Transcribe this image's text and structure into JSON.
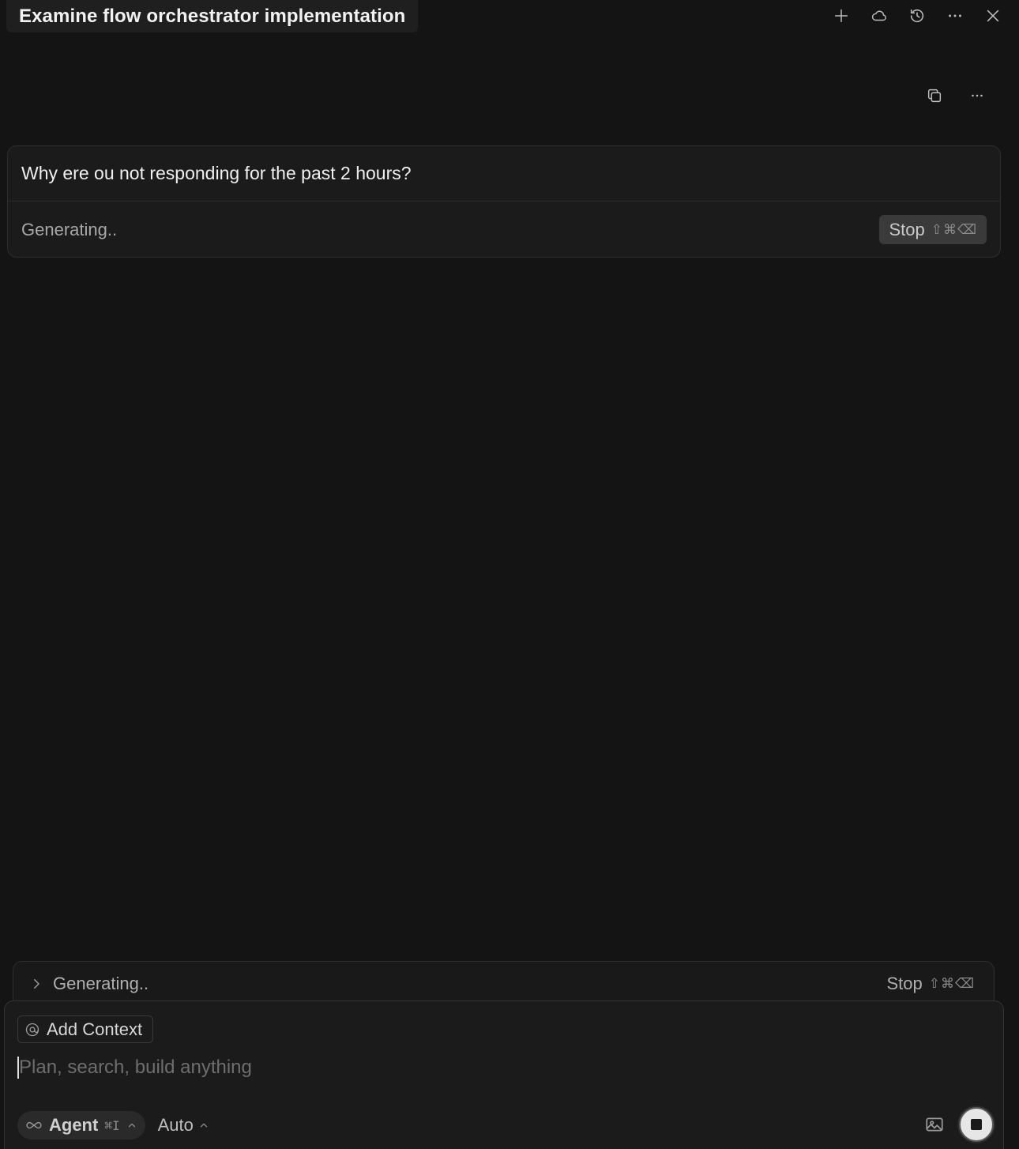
{
  "header": {
    "title": "Examine flow orchestrator implementation",
    "actions": [
      "plus-icon",
      "cloud-icon",
      "history-icon",
      "more-icon",
      "close-icon"
    ]
  },
  "message": {
    "text": "Why ere ou not responding for the past 2 hours?",
    "status": "Generating..",
    "stop_label": "Stop",
    "stop_shortcut": "⇧⌘⌫"
  },
  "generation_bar": {
    "status": "Generating..",
    "stop_label": "Stop",
    "stop_shortcut": "⇧⌘⌫"
  },
  "composer": {
    "add_context_label": "Add Context",
    "placeholder": "Plan, search, build anything",
    "agent_label": "Agent",
    "agent_shortcut": "⌘I",
    "model_label": "Auto"
  }
}
